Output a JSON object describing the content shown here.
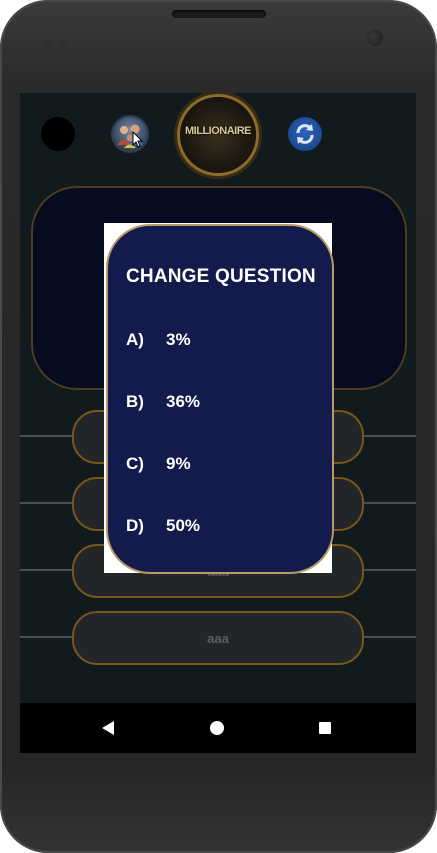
{
  "logo": {
    "title": "MILLIONAIRE",
    "subtitle": ""
  },
  "lifelines": [
    {
      "name": "ask-audience",
      "icon": "audience-icon"
    },
    {
      "name": "change-question",
      "icon": "refresh-icon"
    }
  ],
  "answers": [
    {
      "label": ""
    },
    {
      "label": ""
    },
    {
      "label": "aaa"
    },
    {
      "label": "aaa"
    }
  ],
  "dialog": {
    "title": "CHANGE QUESTION",
    "options": [
      {
        "letter": "A)",
        "value": "3%"
      },
      {
        "letter": "B)",
        "value": "36%"
      },
      {
        "letter": "C)",
        "value": "9%"
      },
      {
        "letter": "D)",
        "value": "50%"
      }
    ]
  },
  "colors": {
    "screen_bg": "#111a1c",
    "dialog_bg": "#131b4d",
    "dialog_border": "#b89a6a",
    "answer_border": "#7a561a",
    "question_bg": "#060b20"
  }
}
